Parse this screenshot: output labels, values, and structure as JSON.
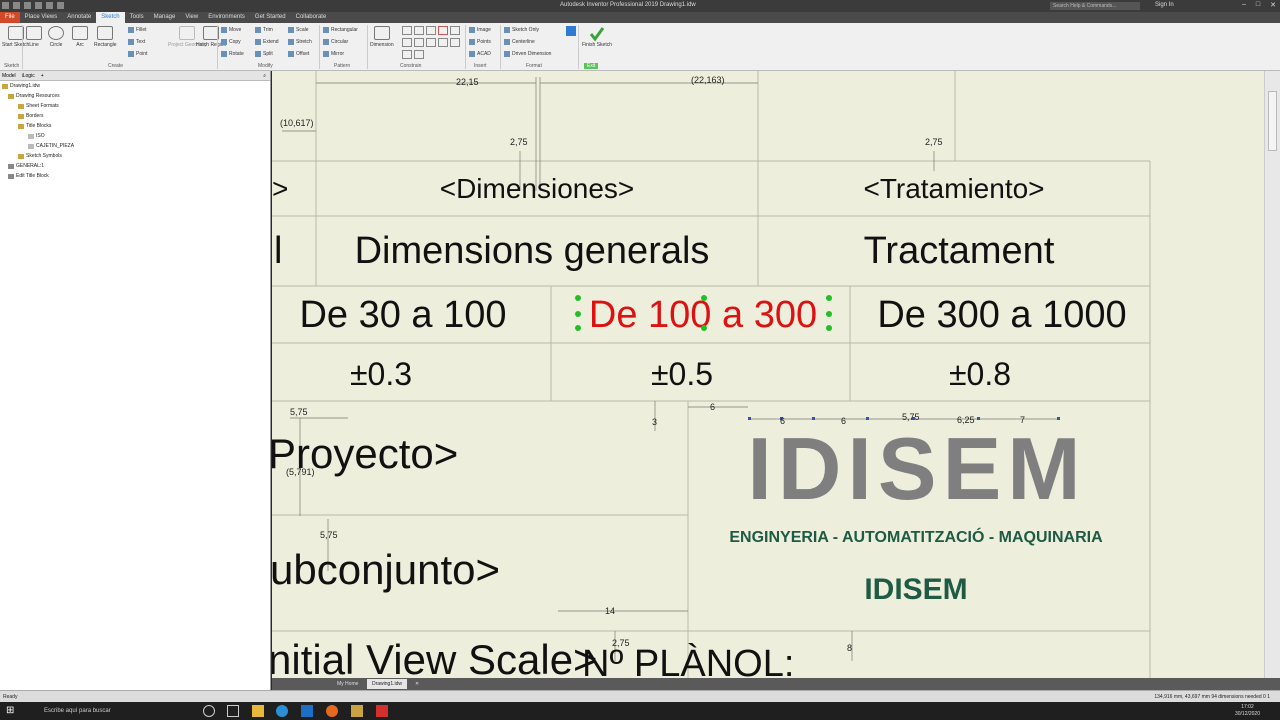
{
  "window": {
    "title": "Autodesk Inventor Professional 2019    Drawing1.idw",
    "search_placeholder": "Search Help & Commands...",
    "sign_in": "Sign In"
  },
  "tabs": [
    "File",
    "Place Views",
    "Annotate",
    "Sketch",
    "Tools",
    "Manage",
    "View",
    "Environments",
    "Get Started",
    "Collaborate"
  ],
  "ribbon": {
    "start_sketch": "Start Sketch",
    "line": "Line",
    "circle": "Circle",
    "arc": "Arc",
    "rectangle": "Rectangle",
    "fillet": "Fillet",
    "text": "Text",
    "point": "Point",
    "project_geometry": "Project Geometry",
    "hatch_region": "Hatch Region",
    "move": "Move",
    "copy": "Copy",
    "rotate": "Rotate",
    "trim": "Trim",
    "extend": "Extend",
    "split": "Split",
    "scale": "Scale",
    "stretch": "Stretch",
    "offset": "Offset",
    "rect_pattern": "Rectangular",
    "circular_pattern": "Circular",
    "mirror": "Mirror",
    "dimension": "Dimension",
    "image": "Image",
    "points": "Points",
    "acad": "ACAD",
    "sketch_only": "Sketch Only",
    "centerline": "Centerline",
    "driven_dimension": "Driven Dimension",
    "finish_sketch": "Finish Sketch",
    "groups": {
      "sketch": "Sketch",
      "create": "Create",
      "modify": "Modify",
      "pattern": "Pattern",
      "constrain": "Constrain",
      "insert": "Insert",
      "format": "Format",
      "exit": "Exit"
    }
  },
  "browser": {
    "tab_model": "Model",
    "tab_ilogic": "iLogic",
    "tree": [
      {
        "label": "Drawing1.idw",
        "indent": 0
      },
      {
        "label": "Drawing Resources",
        "indent": 1
      },
      {
        "label": "Sheet Formats",
        "indent": 2
      },
      {
        "label": "Borders",
        "indent": 2
      },
      {
        "label": "Title Blocks",
        "indent": 2
      },
      {
        "label": "ISO",
        "indent": 3
      },
      {
        "label": "CAJETIN_PIEZA",
        "indent": 3
      },
      {
        "label": "Sketch Symbols",
        "indent": 2
      },
      {
        "label": "GENERAL:1",
        "indent": 1
      },
      {
        "label": "Edit Title Block",
        "indent": 1
      }
    ]
  },
  "drawing": {
    "row1_left": ">",
    "row1_dimensiones": "<Dimensiones>",
    "row1_tratamiento": "<Tratamiento>",
    "row2_left": "l",
    "row2_dimensions": "Dimensions generals",
    "row2_tractament": "Tractament",
    "range1": "De 30 a 100",
    "range2": "De 100 a 300",
    "range3": "De 300 a 1000",
    "tol1": "±0.3",
    "tol2": "±0.5",
    "tol3": "±0.8",
    "proyecto": "Proyecto>",
    "subconjunto": "ubconjunto>",
    "initial_view": "nitial View Scale>",
    "nplanol": "Nº PLÀNOL:",
    "company_logo": "IDISEM",
    "company_tagline": "ENGINYERIA  -  AUTOMATITZACIÓ -  MAQUINARIA",
    "company_name": "IDISEM",
    "dims": {
      "d1": "22,15",
      "d2": "(22,163)",
      "d3": "(10,617)",
      "d4": "2,75",
      "d5": "2,75",
      "d6": "5,75",
      "d7": "(5,791)",
      "d8": "5,75",
      "d9": "6",
      "d10": "6",
      "d11": "6",
      "d12": "5,75",
      "d13": "6,25",
      "d14": "7",
      "d15": "3",
      "d16": "14",
      "d17": "2,75",
      "d18": "8"
    }
  },
  "doc_tabs": [
    "My Home",
    "Drawing1.idw"
  ],
  "status": {
    "left": "Ready",
    "right": "134,916 mm, 43,697 mm  94 dimensions needed  0  1"
  },
  "taskbar": {
    "search": "Escribe aquí para buscar",
    "time": "17:02",
    "date": "30/12/2020"
  },
  "colors": {
    "accent_red": "#dd1111",
    "logo_gray": "#7f7f7f",
    "company_green": "#1e5a44",
    "handle_green": "#22c122"
  }
}
